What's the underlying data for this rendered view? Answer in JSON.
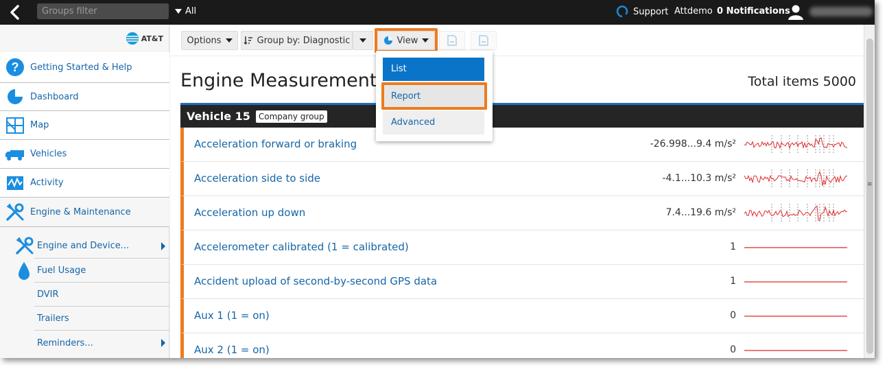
{
  "topbar": {
    "filter_placeholder": "Groups filter",
    "all_label": "All",
    "support_label": "Support",
    "user_label": "Attdemo",
    "notifications_label": "0 Notifications"
  },
  "sidebar": {
    "brand": "AT&T",
    "items": [
      {
        "label": "Getting Started & Help",
        "icon": "help-circle-icon"
      },
      {
        "label": "Dashboard",
        "icon": "pie-chart-icon"
      },
      {
        "label": "Map",
        "icon": "map-icon"
      },
      {
        "label": "Vehicles",
        "icon": "truck-icon"
      },
      {
        "label": "Activity",
        "icon": "activity-icon"
      },
      {
        "label": "Engine & Maintenance",
        "icon": "wrench-screwdriver-icon"
      }
    ],
    "sub_items": [
      {
        "label": "Engine and Device...",
        "icon": "wrench-screwdriver-icon",
        "has_arrow": true
      },
      {
        "label": "Fuel Usage",
        "icon": "fuel-drop-icon",
        "has_arrow": false
      },
      {
        "label": "DVIR",
        "has_arrow": false
      },
      {
        "label": "Trailers",
        "has_arrow": false
      },
      {
        "label": "Reminders...",
        "has_arrow": true
      }
    ]
  },
  "toolbar": {
    "options_label": "Options",
    "group_by_label": "Group by: Diagnostic",
    "view_label": "View"
  },
  "page": {
    "title": "Engine Measurements",
    "total_label": "Total items",
    "total_value": "5000"
  },
  "group": {
    "title": "Vehicle 15",
    "badge": "Company group"
  },
  "rows": [
    {
      "name": "Acceleration forward or braking",
      "value": "-26.998...9.4 m/s²",
      "spark": "noisy"
    },
    {
      "name": "Acceleration side to side",
      "value": "-4.1...10.3 m/s²",
      "spark": "noisy"
    },
    {
      "name": "Acceleration up down",
      "value": "7.4...19.6 m/s²",
      "spark": "noisy"
    },
    {
      "name": "Accelerometer calibrated (1 = calibrated)",
      "value": "1",
      "spark": "flat"
    },
    {
      "name": "Accident upload of second-by-second GPS data",
      "value": "1",
      "spark": "flat"
    },
    {
      "name": "Aux 1 (1 = on)",
      "value": "0",
      "spark": "flat"
    },
    {
      "name": "Aux 2 (1 = on)",
      "value": "0",
      "spark": "flat"
    }
  ],
  "view_menu": {
    "items": [
      "List",
      "Report",
      "Advanced"
    ],
    "selected": "List",
    "highlighted": "Report"
  },
  "colors": {
    "accent_orange": "#ed7b1f",
    "link_blue": "#1565a8",
    "selected_blue": "#0a74c8",
    "topbar": "#1a1a1a",
    "spark_red": "#e0282a"
  }
}
